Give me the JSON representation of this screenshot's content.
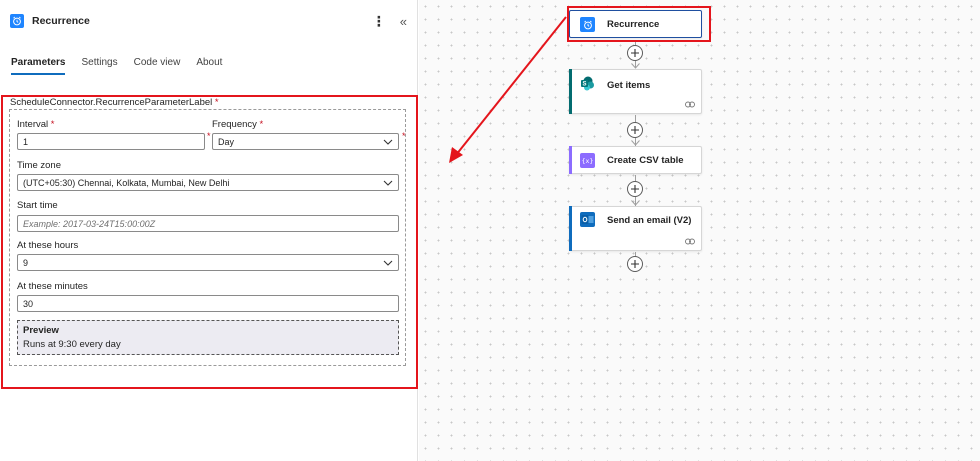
{
  "panel": {
    "title": "Recurrence",
    "tabs": [
      "Parameters",
      "Settings",
      "Code view",
      "About"
    ],
    "active_tab": "Parameters",
    "schedule_label": "ScheduleConnector.RecurrenceParameterLabel",
    "required_marker": "*",
    "fields": {
      "interval": {
        "label": "Interval",
        "value": "1"
      },
      "frequency": {
        "label": "Frequency",
        "value": "Day"
      },
      "time_zone": {
        "label": "Time zone",
        "value": "(UTC+05:30) Chennai, Kolkata, Mumbai, New Delhi"
      },
      "start_time": {
        "label": "Start time",
        "placeholder": "Example: 2017-03-24T15:00:00Z"
      },
      "hours": {
        "label": "At these hours",
        "value": "9"
      },
      "minutes": {
        "label": "At these minutes",
        "value": "30"
      }
    },
    "preview": {
      "title": "Preview",
      "text": "Runs at 9:30 every day"
    }
  },
  "flow": {
    "steps": [
      {
        "title": "Recurrence",
        "icon": "alarm-clock-icon",
        "color": "#1f85ff"
      },
      {
        "title": "Get items",
        "icon": "sharepoint-icon",
        "color": "#036c70"
      },
      {
        "title": "Create CSV table",
        "icon": "data-operation-icon",
        "color": "#8c6cff"
      },
      {
        "title": "Send an email (V2)",
        "icon": "outlook-icon",
        "color": "#0f6cbd"
      }
    ]
  },
  "colors": {
    "accent": "#0f6cbd",
    "highlight": "#e4151c"
  }
}
